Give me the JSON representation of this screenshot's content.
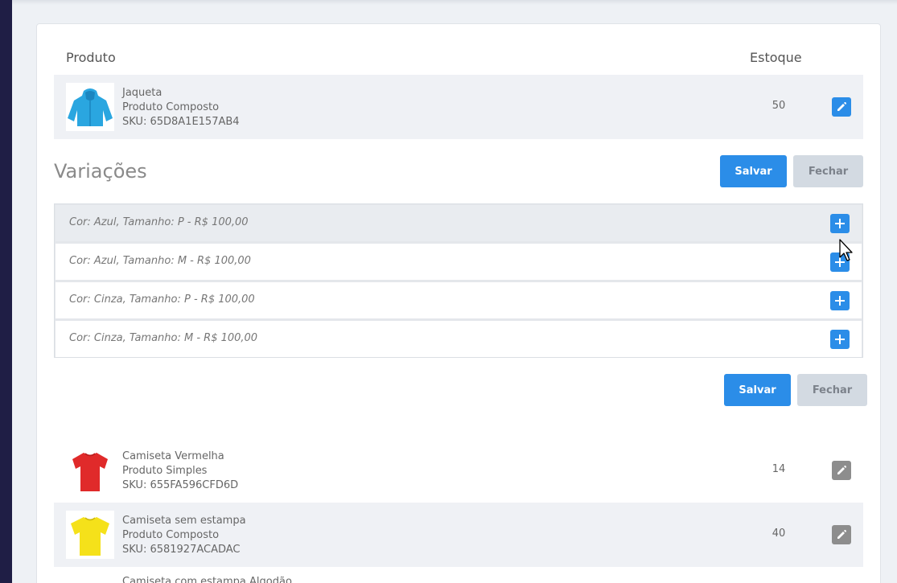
{
  "table": {
    "col_product": "Produto",
    "col_stock": "Estoque"
  },
  "products": [
    {
      "name": "Jaqueta",
      "type": "Produto Composto",
      "sku": "SKU: 65D8A1E157AB4",
      "stock": "50",
      "image": "blue-jacket"
    },
    {
      "name": "Camiseta Vermelha",
      "type": "Produto Simples",
      "sku": "SKU: 655FA596CFD6D",
      "stock": "14",
      "image": "red-tshirt"
    },
    {
      "name": "Camiseta sem estampa",
      "type": "Produto Composto",
      "sku": "SKU: 6581927ACADAC",
      "stock": "40",
      "image": "yellow-tshirt"
    }
  ],
  "variations": {
    "title": "Variações",
    "items": [
      "Cor: Azul, Tamanho: P - R$ 100,00",
      "Cor: Azul, Tamanho: M - R$ 100,00",
      "Cor: Cinza, Tamanho: P - R$ 100,00",
      "Cor: Cinza, Tamanho: M - R$ 100,00"
    ]
  },
  "buttons": {
    "save": "Salvar",
    "close": "Fechar"
  },
  "partial_next_row": "Camiseta com estampa Algodão",
  "colors": {
    "accent": "#2b8de8",
    "close_button": "#d3dae2",
    "sidebar": "#1f1e45"
  }
}
